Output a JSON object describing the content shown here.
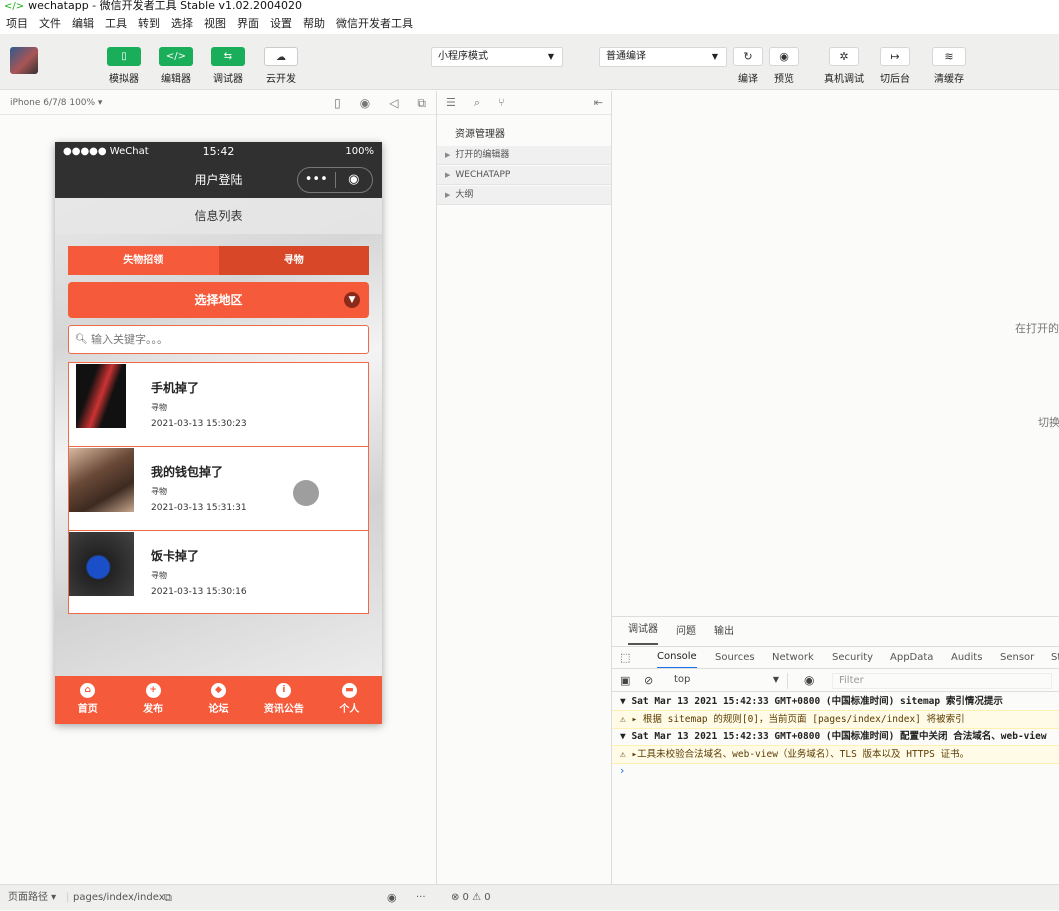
{
  "window": {
    "title": "wechatapp - 微信开发者工具 Stable v1.02.2004020"
  },
  "menu": [
    "项目",
    "文件",
    "编辑",
    "工具",
    "转到",
    "选择",
    "视图",
    "界面",
    "设置",
    "帮助",
    "微信开发者工具"
  ],
  "toolbar": {
    "left_buttons": [
      {
        "label": "模拟器",
        "glyph": "▯"
      },
      {
        "label": "编辑器",
        "glyph": "</>"
      },
      {
        "label": "调试器",
        "glyph": "⇆"
      },
      {
        "label": "云开发",
        "glyph": "☁"
      }
    ],
    "mode_select": "小程序模式",
    "compile_select": "普通编译",
    "right_buttons": [
      {
        "label": "编译",
        "glyph": "↻"
      },
      {
        "label": "预览",
        "glyph": "◉"
      },
      {
        "label": "真机调试",
        "glyph": "✲"
      },
      {
        "label": "切后台",
        "glyph": "↦"
      },
      {
        "label": "清缓存",
        "glyph": "≋"
      }
    ]
  },
  "simulator": {
    "device": "iPhone 6/7/8 100% ▾",
    "status": {
      "carrier": "●●●●● WeChat",
      "time": "15:42",
      "battery": "100%"
    },
    "nav_title": "用户登陆",
    "page_header": "信息列表",
    "tabs": [
      "失物招领",
      "寻物"
    ],
    "region_button": "选择地区",
    "search_placeholder": "输入关键字。。。",
    "items": [
      {
        "title": "手机掉了",
        "type": "寻物",
        "date": "2021-03-13 15:30:23"
      },
      {
        "title": "我的钱包掉了",
        "type": "寻物",
        "date": "2021-03-13 15:31:31"
      },
      {
        "title": "饭卡掉了",
        "type": "寻物",
        "date": "2021-03-13 15:30:16"
      }
    ],
    "tabbar": [
      {
        "label": "首页",
        "glyph": "⌂"
      },
      {
        "label": "发布",
        "glyph": "+"
      },
      {
        "label": "论坛",
        "glyph": "◆"
      },
      {
        "label": "资讯公告",
        "glyph": "i"
      },
      {
        "label": "个人",
        "glyph": "▬"
      }
    ]
  },
  "explorer": {
    "title": "资源管理器",
    "sections": [
      "打开的编辑器",
      "WECHATAPP",
      "大纲"
    ]
  },
  "editor_hints": [
    "在打开的",
    "切换"
  ],
  "debugger": {
    "tabs": [
      "调试器",
      "问题",
      "输出"
    ],
    "devtools_tabs": [
      "Console",
      "Sources",
      "Network",
      "Security",
      "AppData",
      "Audits",
      "Sensor",
      "St"
    ],
    "context": "top",
    "filter_placeholder": "Filter",
    "logs": [
      {
        "kind": "info",
        "text": "▼ Sat Mar 13 2021 15:42:33 GMT+0800 (中国标准时间) sitemap 索引情况提示"
      },
      {
        "kind": "warn",
        "text": "⚠ ▸ 根据 sitemap 的规则[0]，当前页面 [pages/index/index] 将被索引"
      },
      {
        "kind": "info",
        "text": "▼ Sat Mar 13 2021 15:42:33 GMT+0800 (中国标准时间) 配置中关闭 合法域名、web-view"
      },
      {
        "kind": "warn",
        "text": "⚠ ▸工具未校验合法域名、web-view（业务域名）、TLS 版本以及 HTTPS 证书。"
      }
    ]
  },
  "footer": {
    "path_label": "页面路径 ▾",
    "path": "pages/index/index",
    "errors": "⊗ 0 ⚠ 0"
  }
}
